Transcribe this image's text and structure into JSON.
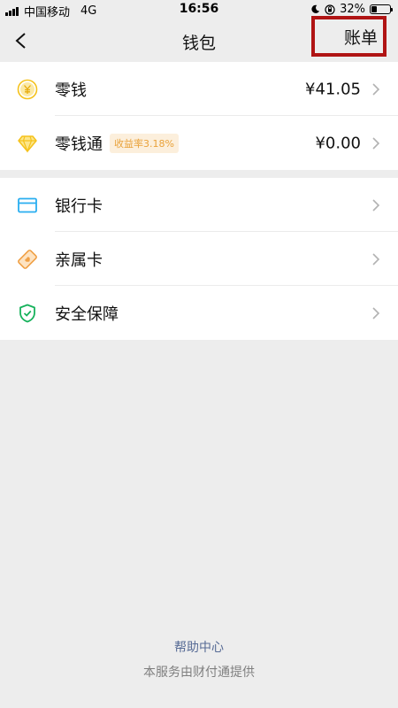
{
  "status_bar": {
    "carrier": "中国移动",
    "network": "4G",
    "time": "16:56",
    "battery_percent": "32%",
    "battery_level": 0.32
  },
  "nav": {
    "title": "钱包",
    "bill_label": "账单"
  },
  "wallet_items": [
    {
      "label": "零钱",
      "value": "¥41.05",
      "icon": "yuan-coin-icon"
    },
    {
      "label": "零钱通",
      "badge": "收益率3.18%",
      "value": "¥0.00",
      "icon": "diamond-icon"
    }
  ],
  "service_items": [
    {
      "label": "银行卡",
      "icon": "bank-card-icon"
    },
    {
      "label": "亲属卡",
      "icon": "family-card-icon"
    },
    {
      "label": "安全保障",
      "icon": "shield-icon"
    }
  ],
  "footer": {
    "help": "帮助中心",
    "provider": "本服务由财付通提供"
  },
  "colors": {
    "background": "#ededed",
    "yellow_icon": "#f5c21b",
    "blue_icon": "#2aaef0",
    "orange_icon": "#f0a045",
    "green_icon": "#17b25c",
    "link": "#576b95",
    "highlight_box": "#b01414"
  }
}
